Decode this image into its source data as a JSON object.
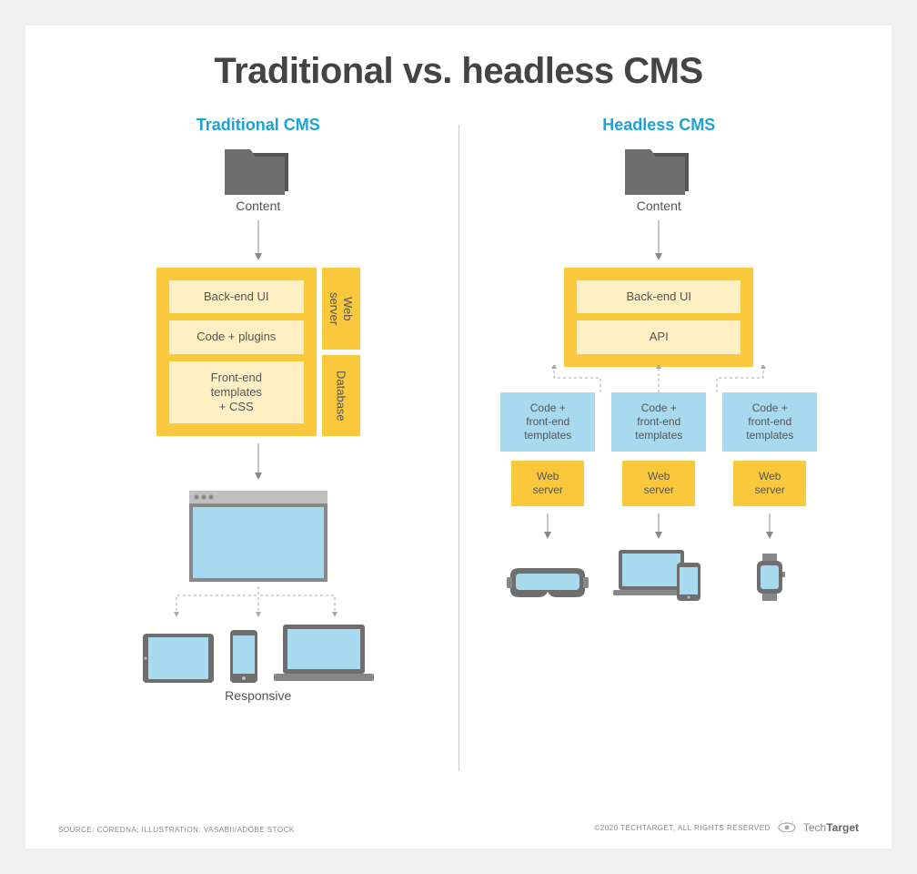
{
  "title": "Traditional vs. headless CMS",
  "traditional": {
    "heading": "Traditional CMS",
    "content_label": "Content",
    "stack": [
      "Back-end UI",
      "Code + plugins",
      "Front-end\ntemplates\n+ CSS"
    ],
    "side": [
      "Web\nserver",
      "Database"
    ],
    "responsive_label": "Responsive"
  },
  "headless": {
    "heading": "Headless CMS",
    "content_label": "Content",
    "stack": [
      "Back-end UI",
      "API"
    ],
    "channel_template": "Code +\nfront-end\ntemplates",
    "channel_server": "Web\nserver",
    "channels": [
      "vr-headset",
      "laptop-phone",
      "smartwatch"
    ]
  },
  "footer": {
    "source": "SOURCE: COREDNA; ILLUSTRATION: VASABII/ADOBE STOCK",
    "copyright": "©2020 TECHTARGET, ALL RIGHTS RESERVED",
    "brand_light": "Tech",
    "brand_bold": "Target"
  }
}
